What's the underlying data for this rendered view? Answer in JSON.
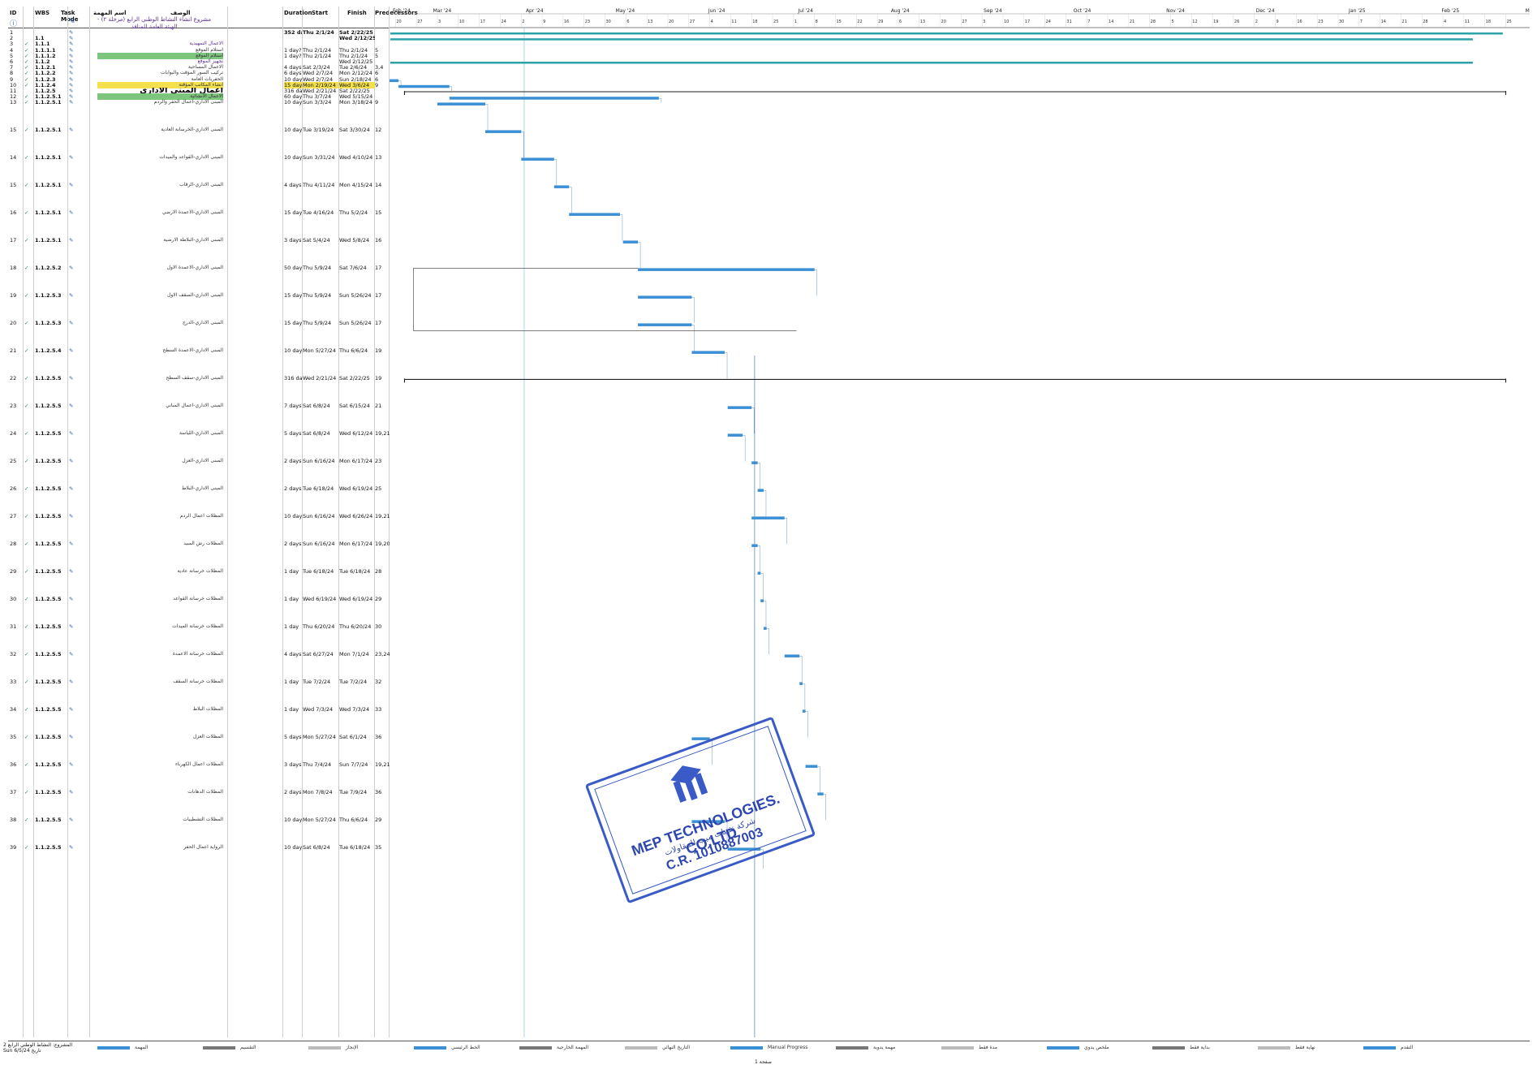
{
  "header": {
    "columns": {
      "id": "ID",
      "wbs": "WBS",
      "mode": "Task Mode",
      "desc": "الوصف",
      "name": "اسم المهمة",
      "duration": "Duration",
      "start": "Start",
      "finish": "Finish",
      "pred": "Predecessors"
    },
    "info_icon": "ⓘ",
    "mode_icon": "✎"
  },
  "project_title": "مشروع انشاء النشاط الوطني الرابع (مرحلة ٢) - الهيئة العامة للمنافذ",
  "rows": [
    {
      "id": "1",
      "chk": "",
      "wbs": "",
      "name": "",
      "duration": "352 days?",
      "start": "Thu 2/1/24",
      "finish": "Sat 2/22/25",
      "pred": "",
      "type": "summary"
    },
    {
      "id": "2",
      "chk": "",
      "wbs": "1.1",
      "name": "",
      "duration": "",
      "start": "",
      "finish": "Wed 2/12/25",
      "pred": "",
      "type": "summary"
    },
    {
      "id": "3",
      "chk": "✓",
      "wbs": "1.1.1",
      "name": "الاعمال التمهيدية",
      "duration": "",
      "start": "",
      "finish": "",
      "pred": "",
      "type": "purple"
    },
    {
      "id": "4",
      "chk": "✓",
      "wbs": "1.1.1.1",
      "name": "استلام الموقع",
      "duration": "1 day?",
      "start": "Thu 2/1/24",
      "finish": "Thu 2/1/24",
      "pred": "5",
      "type": "normal"
    },
    {
      "id": "5",
      "chk": "✓",
      "wbs": "1.1.1.2",
      "name": "استلام الموقع",
      "duration": "1 day?",
      "start": "Thu 2/1/24",
      "finish": "Thu 2/1/24",
      "pred": "5",
      "type": "hl-green"
    },
    {
      "id": "6",
      "chk": "✓",
      "wbs": "1.1.2",
      "name": "تجهيز الموقع",
      "duration": "",
      "start": "",
      "finish": "Wed 2/12/25",
      "pred": "",
      "type": "purple"
    },
    {
      "id": "7",
      "chk": "✓",
      "wbs": "1.1.2.1",
      "name": "الاعمال المساحية",
      "duration": "4 days",
      "start": "Sat 2/3/24",
      "finish": "Tue 2/6/24",
      "pred": "3,4",
      "type": "normal"
    },
    {
      "id": "8",
      "chk": "✓",
      "wbs": "1.1.2.2",
      "name": "تركيب السور المؤقت والبوابات",
      "duration": "6 days",
      "start": "Wed 2/7/24",
      "finish": "Mon 2/12/24",
      "pred": "6",
      "type": "normal"
    },
    {
      "id": "9",
      "chk": "✓",
      "wbs": "1.1.2.3",
      "name": "الحفريات العامة",
      "duration": "10 days",
      "start": "Wed 2/7/24",
      "finish": "Sun 2/18/24",
      "pred": "6",
      "type": "normal"
    },
    {
      "id": "10",
      "chk": "✓",
      "wbs": "1.1.2.4",
      "name": "انشاء المكاتب المؤقتة",
      "duration": "15 days",
      "start": "Mon 2/19/24",
      "finish": "Wed 3/6/24",
      "pred": "9",
      "type": "hl-yellow"
    },
    {
      "id": "11",
      "chk": "",
      "wbs": "1.1.2.5",
      "name": "اعمال المبنى الاداري",
      "duration": "316 days",
      "start": "Wed 2/21/24",
      "finish": "Sat 2/22/25",
      "pred": "",
      "type": "big"
    },
    {
      "id": "12",
      "chk": "✓",
      "wbs": "1.1.2.5.1",
      "name": "الاعمال الانشائية",
      "duration": "60 days",
      "start": "Thu 3/7/24",
      "finish": "Wed 5/15/24",
      "pred": "",
      "type": "hl-green"
    },
    {
      "id": "13",
      "chk": "✓",
      "wbs": "1.1.2.5.1",
      "name": "المبنى الاداري-اعمال الحفر والردم",
      "duration": "10 days",
      "start": "Sun 3/3/24",
      "finish": "Mon 3/18/24",
      "pred": "9",
      "type": "normal"
    },
    {
      "id": "15",
      "chk": "✓",
      "wbs": "1.1.2.5.1",
      "name": "المبنى الاداري-الخرسانة العادية",
      "duration": "10 days",
      "start": "Tue 3/19/24",
      "finish": "Sat 3/30/24",
      "pred": "12",
      "type": "normal"
    },
    {
      "id": "14",
      "chk": "✓",
      "wbs": "1.1.2.5.1",
      "name": "المبنى الاداري-القواعد والميدات",
      "duration": "10 days",
      "start": "Sun 3/31/24",
      "finish": "Wed 4/10/24",
      "pred": "13",
      "type": "normal"
    },
    {
      "id": "15",
      "chk": "✓",
      "wbs": "1.1.2.5.1",
      "name": "المبنى الاداري-الرقاب",
      "duration": "4 days",
      "start": "Thu 4/11/24",
      "finish": "Mon 4/15/24",
      "pred": "14",
      "type": "normal"
    },
    {
      "id": "16",
      "chk": "✓",
      "wbs": "1.1.2.5.1",
      "name": "المبنى الاداري-الاعمدة الارضي",
      "duration": "15 days",
      "start": "Tue 4/16/24",
      "finish": "Thu 5/2/24",
      "pred": "15",
      "type": "normal"
    },
    {
      "id": "17",
      "chk": "✓",
      "wbs": "1.1.2.5.1",
      "name": "المبنى الاداري-البلاطة الارضية",
      "duration": "3 days",
      "start": "Sat 5/4/24",
      "finish": "Wed 5/8/24",
      "pred": "16",
      "type": "normal"
    },
    {
      "id": "18",
      "chk": "✓",
      "wbs": "1.1.2.5.2",
      "name": "المبنى الاداري-الاعمدة الاول",
      "duration": "50 days",
      "start": "Thu 5/9/24",
      "finish": "Sat 7/6/24",
      "pred": "17",
      "type": "normal"
    },
    {
      "id": "19",
      "chk": "✓",
      "wbs": "1.1.2.5.3",
      "name": "المبنى الاداري-السقف الاول",
      "duration": "15 days",
      "start": "Thu 5/9/24",
      "finish": "Sun 5/26/24",
      "pred": "17",
      "type": "normal"
    },
    {
      "id": "20",
      "chk": "✓",
      "wbs": "1.1.2.5.3",
      "name": "المبنى الاداري-الدرج",
      "duration": "15 days",
      "start": "Thu 5/9/24",
      "finish": "Sun 5/26/24",
      "pred": "17",
      "type": "normal"
    },
    {
      "id": "21",
      "chk": "✓",
      "wbs": "1.1.2.5.4",
      "name": "المبنى الاداري-الاعمدة السطح",
      "duration": "10 days",
      "start": "Mon 5/27/24",
      "finish": "Thu 6/6/24",
      "pred": "19",
      "type": "normal"
    },
    {
      "id": "22",
      "chk": "✓",
      "wbs": "1.1.2.5.5",
      "name": "المبنى الاداري-سقف السطح",
      "duration": "316 days",
      "start": "Wed 2/21/24",
      "finish": "Sat 2/22/25",
      "pred": "19",
      "type": "normal"
    },
    {
      "id": "23",
      "chk": "✓",
      "wbs": "1.1.2.5.5",
      "name": "المبنى الاداري-اعمال المباني",
      "duration": "7 days",
      "start": "Sat 6/8/24",
      "finish": "Sat 6/15/24",
      "pred": "21",
      "type": "normal"
    },
    {
      "id": "24",
      "chk": "✓",
      "wbs": "1.1.2.5.5",
      "name": "المبنى الاداري-اللياسة",
      "duration": "5 days",
      "start": "Sat 6/8/24",
      "finish": "Wed 6/12/24",
      "pred": "19,21",
      "type": "normal"
    },
    {
      "id": "25",
      "chk": "✓",
      "wbs": "1.1.2.5.5",
      "name": "المبنى الاداري-العزل",
      "duration": "2 days",
      "start": "Sun 6/16/24",
      "finish": "Mon 6/17/24",
      "pred": "23",
      "type": "normal"
    },
    {
      "id": "26",
      "chk": "✓",
      "wbs": "1.1.2.5.5",
      "name": "المبنى الاداري-البلاط",
      "duration": "2 days",
      "start": "Tue 6/18/24",
      "finish": "Wed 6/19/24",
      "pred": "25",
      "type": "normal"
    },
    {
      "id": "27",
      "chk": "✓",
      "wbs": "1.1.2.5.5",
      "name": "المظلات اعمال الردم",
      "duration": "10 days",
      "start": "Sun 6/16/24",
      "finish": "Wed 6/26/24",
      "pred": "19,21",
      "type": "normal"
    },
    {
      "id": "28",
      "chk": "✓",
      "wbs": "1.1.2.5.5",
      "name": "المظلات رش المبيد",
      "duration": "2 days",
      "start": "Sun 6/16/24",
      "finish": "Mon 6/17/24",
      "pred": "19,20",
      "type": "normal"
    },
    {
      "id": "29",
      "chk": "✓",
      "wbs": "1.1.2.5.5",
      "name": "المظلات خرسانة عادية",
      "duration": "1 day",
      "start": "Tue 6/18/24",
      "finish": "Tue 6/18/24",
      "pred": "28",
      "type": "normal"
    },
    {
      "id": "30",
      "chk": "✓",
      "wbs": "1.1.2.5.5",
      "name": "المظلات خرسانة القواعد",
      "duration": "1 day",
      "start": "Wed 6/19/24",
      "finish": "Wed 6/19/24",
      "pred": "29",
      "type": "normal"
    },
    {
      "id": "31",
      "chk": "✓",
      "wbs": "1.1.2.5.5",
      "name": "المظلات خرسانة الميدات",
      "duration": "1 day",
      "start": "Thu 6/20/24",
      "finish": "Thu 6/20/24",
      "pred": "30",
      "type": "normal"
    },
    {
      "id": "32",
      "chk": "✓",
      "wbs": "1.1.2.5.5",
      "name": "المظلات خرسانة الاعمدة",
      "duration": "4 days",
      "start": "Sat 6/27/24",
      "finish": "Mon 7/1/24",
      "pred": "23,24",
      "type": "normal"
    },
    {
      "id": "33",
      "chk": "✓",
      "wbs": "1.1.2.5.5",
      "name": "المظلات خرسانة السقف",
      "duration": "1 day",
      "start": "Tue 7/2/24",
      "finish": "Tue 7/2/24",
      "pred": "32",
      "type": "normal"
    },
    {
      "id": "34",
      "chk": "✓",
      "wbs": "1.1.2.5.5",
      "name": "المظلات البلاط",
      "duration": "1 day",
      "start": "Wed 7/3/24",
      "finish": "Wed 7/3/24",
      "pred": "33",
      "type": "normal"
    },
    {
      "id": "35",
      "chk": "✓",
      "wbs": "1.1.2.5.5",
      "name": "المظلات العزل",
      "duration": "5 days",
      "start": "Mon 5/27/24",
      "finish": "Sat 6/1/24",
      "pred": "36",
      "type": "normal"
    },
    {
      "id": "36",
      "chk": "✓",
      "wbs": "1.1.2.5.5",
      "name": "المظلات اعمال الكهرباء",
      "duration": "3 days",
      "start": "Thu 7/4/24",
      "finish": "Sun 7/7/24",
      "pred": "19,21",
      "type": "normal"
    },
    {
      "id": "37",
      "chk": "✓",
      "wbs": "1.1.2.5.5",
      "name": "المظلات الدهانات",
      "duration": "2 days",
      "start": "Mon 7/8/24",
      "finish": "Tue 7/9/24",
      "pred": "36",
      "type": "normal"
    },
    {
      "id": "38",
      "chk": "✓",
      "wbs": "1.1.2.5.5",
      "name": "المظلات التشطيبات",
      "duration": "10 days",
      "start": "Mon 5/27/24",
      "finish": "Thu 6/6/24",
      "pred": "29",
      "type": "normal"
    },
    {
      "id": "39",
      "chk": "✓",
      "wbs": "1.1.2.5.5",
      "name": "الرواية اعمال الحفر",
      "duration": "10 days",
      "start": "Sat 6/8/24",
      "finish": "Tue 6/18/24",
      "pred": "35",
      "type": "normal"
    }
  ],
  "timeline": {
    "months": [
      "Feb '24",
      "Mar '24",
      "Apr '24",
      "May '24",
      "Jun '24",
      "Jul '24",
      "Aug '24",
      "Sep '24",
      "Oct '24",
      "Nov '24",
      "Dec '24",
      "Jan '25",
      "Feb '25",
      "Mar '25"
    ],
    "days": [
      "20",
      "27",
      "3",
      "10",
      "17",
      "24",
      "2",
      "9",
      "16",
      "23",
      "30",
      "6",
      "13",
      "20",
      "27",
      "4",
      "11",
      "18",
      "25",
      "1",
      "8",
      "15",
      "22",
      "29",
      "6",
      "13",
      "20",
      "27",
      "3",
      "10",
      "17",
      "24",
      "31",
      "7",
      "14",
      "21",
      "28",
      "5",
      "12",
      "19",
      "26",
      "2",
      "9",
      "16",
      "23",
      "30",
      "7",
      "14",
      "21",
      "28",
      "4",
      "11",
      "18",
      "25",
      "1",
      "8",
      "15",
      "22",
      "1"
    ],
    "bar_color": "#3b8fd4",
    "summary_color": "#2ba3a8"
  },
  "legend": {
    "items": [
      "المهمة",
      "التقسيم",
      "الإنجاز",
      "الخط الرئيسي",
      "المهمة الخارجية",
      "التاريخ النهائي",
      "Manual Progress",
      "مهمة يدوية",
      "مدة فقط",
      "ملخص يدوي",
      "بداية فقط",
      "نهاية فقط",
      "التقدم"
    ],
    "project_label": "المشروع: النشاط الوطني الرابع 2",
    "date_label": "Sun 6/5/24 تاريخ"
  },
  "page_number": "صفحة 1",
  "stamp": {
    "company": "MEP TECHNOLOGIES. CO.LTD",
    "arabic": "شركة تقنيات ميب للمقاولات",
    "cr": "C.R. 1010887003"
  }
}
